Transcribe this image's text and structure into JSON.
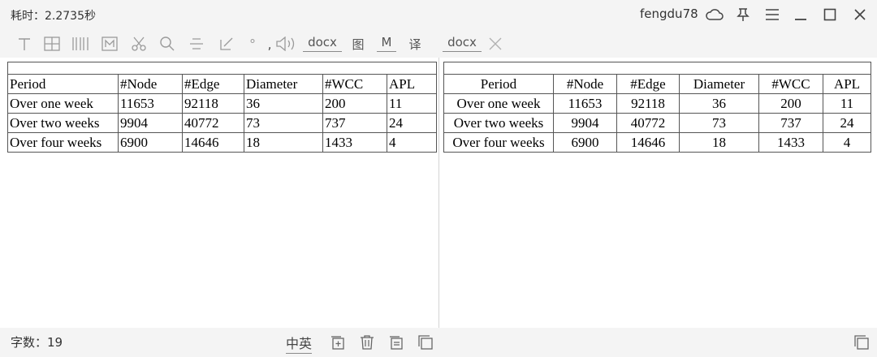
{
  "titlebar": {
    "elapsed": "耗时：2.2735秒",
    "username": "fengdu78"
  },
  "toolbar": {
    "docx1": "docx",
    "img": "图",
    "m": "M",
    "translate": "译",
    "docx2": "docx"
  },
  "left_table": {
    "headers": [
      "Period",
      "#Node",
      "#Edge",
      "Diameter",
      "#WCC",
      "APL"
    ],
    "rows": [
      [
        "Over one week",
        "11653",
        "92118",
        "36",
        "200",
        "11"
      ],
      [
        "Over two weeks",
        "9904",
        "40772",
        "73",
        "737",
        "24"
      ],
      [
        "Over four weeks",
        "6900",
        "14646",
        "18",
        "1433",
        "4"
      ]
    ]
  },
  "right_table": {
    "headers": [
      "Period",
      "#Node",
      "#Edge",
      "Diameter",
      "#WCC",
      "APL"
    ],
    "rows": [
      [
        "Over one week",
        "11653",
        "92118",
        "36",
        "200",
        "11"
      ],
      [
        "Over two weeks",
        "9904",
        "40772",
        "73",
        "737",
        "24"
      ],
      [
        "Over four weeks",
        "6900",
        "14646",
        "18",
        "1433",
        "4"
      ]
    ]
  },
  "statusbar": {
    "word_count": "字数：19",
    "language": "中英"
  }
}
